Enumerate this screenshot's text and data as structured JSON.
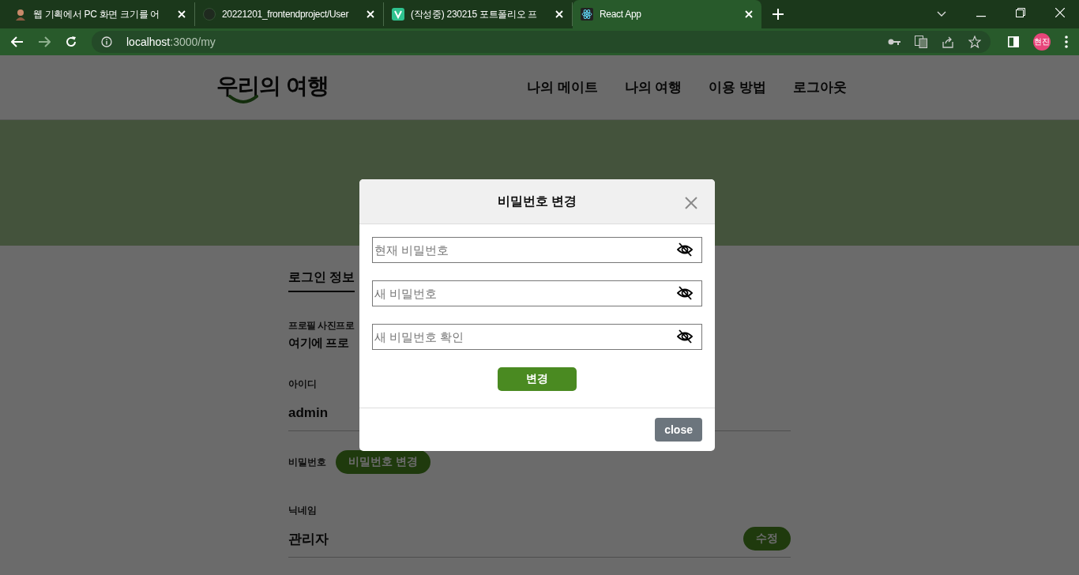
{
  "browser": {
    "tabs": [
      {
        "title": "웹 기획에서 PC 화면 크기를 어",
        "kind": "person",
        "selected": false
      },
      {
        "title": "20221201_frontendproject/User",
        "kind": "github",
        "selected": false
      },
      {
        "title": "(작성중) 230215 포트폴리오 프",
        "kind": "v",
        "selected": false
      },
      {
        "title": "React App",
        "kind": "react",
        "selected": true
      }
    ],
    "url": {
      "host": "localhost",
      "path": ":3000/my"
    },
    "profile": "현진"
  },
  "site": {
    "logo": "우리의 여행",
    "nav": [
      "나의 메이트",
      "나의 여행",
      "이용 방법",
      "로그아웃"
    ],
    "section_tab": "로그인 정보",
    "fields": [
      {
        "kind": "profile",
        "label": "프로필 사진프로",
        "value": "여기에 프로"
      },
      {
        "kind": "text",
        "label": "아이디",
        "value": "admin"
      },
      {
        "kind": "password",
        "label": "비밀번호",
        "button": "비밀번호 변경"
      },
      {
        "kind": "editable",
        "label": "닉네임",
        "value": "관리자",
        "button": "수정"
      }
    ]
  },
  "modal": {
    "title": "비밀번호 변경",
    "inputs": [
      {
        "placeholder": "현재 비밀번호"
      },
      {
        "placeholder": "새 비밀번호"
      },
      {
        "placeholder": "새 비밀번호 확인"
      }
    ],
    "submit": "변경",
    "close": "close"
  }
}
